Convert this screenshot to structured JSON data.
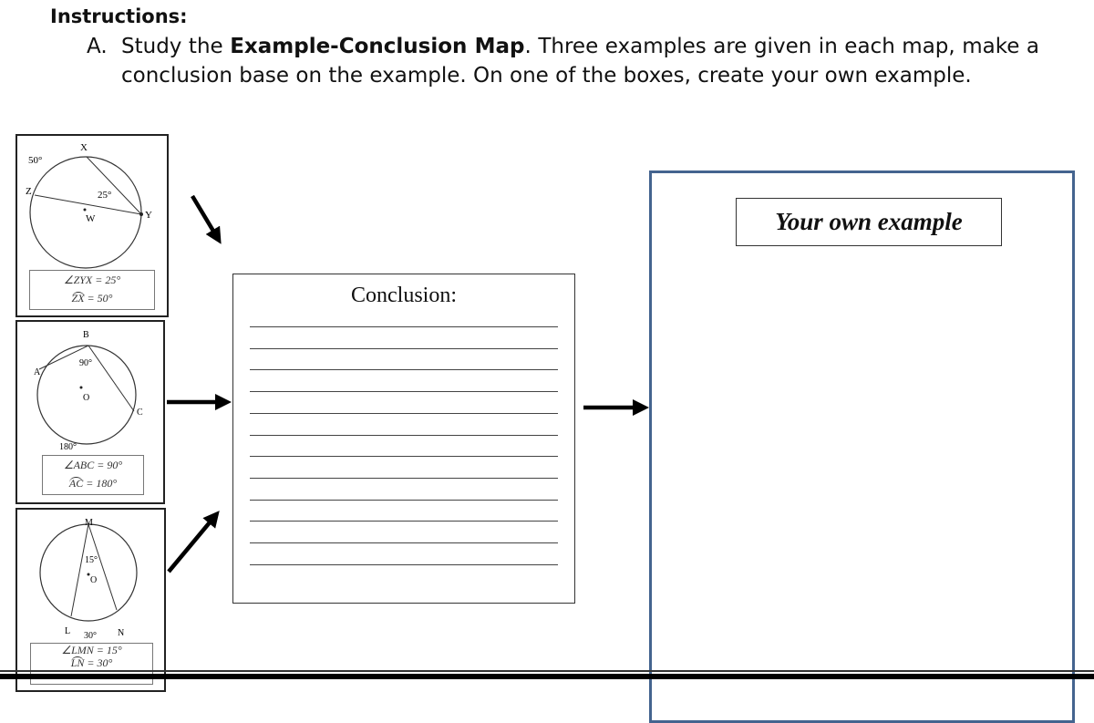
{
  "instructions": {
    "title": "Instructions:",
    "item_letter": "A.",
    "text_pre": "Study the ",
    "text_bold": "Example-Conclusion Map",
    "text_post": ". Three examples are given in each map, make a conclusion base on the example. On one of the boxes, create your own example."
  },
  "examples": [
    {
      "labels": {
        "X": "X",
        "Z": "Z",
        "Y": "Y",
        "center": "W",
        "arc": "50°",
        "angle": "25°"
      },
      "eq1": "∠ZYX = 25°",
      "eq2_arc": "ZX",
      "eq2_rest": " = 50°"
    },
    {
      "labels": {
        "A": "A",
        "B": "B",
        "C": "C",
        "center": "O",
        "angle": "90°",
        "arc": "180°"
      },
      "eq1": "∠ABC = 90°",
      "eq2_arc": "AC",
      "eq2_rest": " = 180°"
    },
    {
      "labels": {
        "M": "M",
        "L": "L",
        "N": "N",
        "center": "O",
        "angle": "15°",
        "arc": "30°"
      },
      "eq1": "∠LMN = 15°",
      "eq2_arc": "LN",
      "eq2_rest": " = 30°"
    }
  ],
  "conclusion": {
    "title": "Conclusion:",
    "line_count": 12
  },
  "own_example": {
    "label": "Your own example"
  },
  "colors": {
    "own_box_border": "#44648f"
  }
}
